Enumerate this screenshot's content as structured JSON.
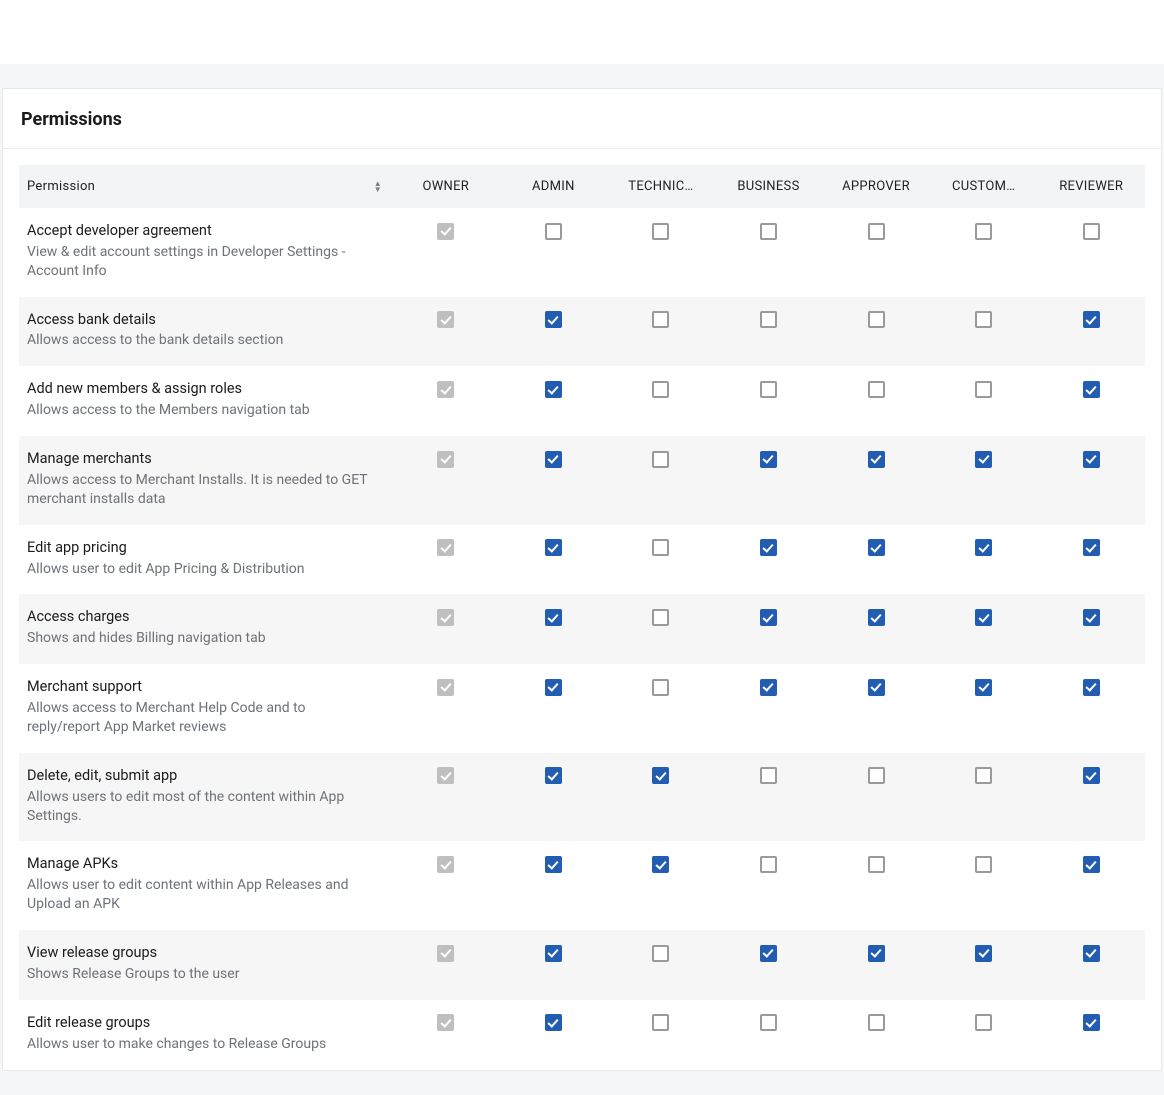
{
  "card_title": "Permissions",
  "columns": [
    "Permission",
    "OWNER",
    "ADMIN",
    "TECHNIC…",
    "BUSINESS",
    "APPROVER",
    "CUSTOM…",
    "REVIEWER"
  ],
  "permissions": [
    {
      "label": "Accept developer agreement",
      "desc": "View & edit account settings in Developer Settings - Account Info",
      "grants": [
        "locked",
        "unchecked",
        "unchecked",
        "unchecked",
        "unchecked",
        "unchecked",
        "unchecked"
      ]
    },
    {
      "label": "Access bank details",
      "desc": "Allows access to the bank details section",
      "grants": [
        "locked",
        "checked",
        "unchecked",
        "unchecked",
        "unchecked",
        "unchecked",
        "checked"
      ]
    },
    {
      "label": "Add new members & assign roles",
      "desc": "Allows access to the Members navigation tab",
      "grants": [
        "locked",
        "checked",
        "unchecked",
        "unchecked",
        "unchecked",
        "unchecked",
        "checked"
      ]
    },
    {
      "label": "Manage merchants",
      "desc": "Allows access to Merchant Installs. It is needed to GET merchant installs data",
      "grants": [
        "locked",
        "checked",
        "unchecked",
        "checked",
        "checked",
        "checked",
        "checked"
      ]
    },
    {
      "label": "Edit app pricing",
      "desc": "Allows user to edit App Pricing & Distribution",
      "grants": [
        "locked",
        "checked",
        "unchecked",
        "checked",
        "checked",
        "checked",
        "checked"
      ]
    },
    {
      "label": "Access charges",
      "desc": "Shows and hides Billing navigation tab",
      "grants": [
        "locked",
        "checked",
        "unchecked",
        "checked",
        "checked",
        "checked",
        "checked"
      ]
    },
    {
      "label": "Merchant support",
      "desc": "Allows access to Merchant Help Code and to reply/report App Market reviews",
      "grants": [
        "locked",
        "checked",
        "unchecked",
        "checked",
        "checked",
        "checked",
        "checked"
      ]
    },
    {
      "label": "Delete, edit, submit app",
      "desc": "Allows users to edit most of the content within App Settings.",
      "grants": [
        "locked",
        "checked",
        "checked",
        "unchecked",
        "unchecked",
        "unchecked",
        "checked"
      ]
    },
    {
      "label": "Manage APKs",
      "desc": "Allows user to edit content within App Releases and Upload an APK",
      "grants": [
        "locked",
        "checked",
        "checked",
        "unchecked",
        "unchecked",
        "unchecked",
        "checked"
      ]
    },
    {
      "label": "View release groups",
      "desc": "Shows Release Groups to the user",
      "grants": [
        "locked",
        "checked",
        "unchecked",
        "checked",
        "checked",
        "checked",
        "checked"
      ]
    },
    {
      "label": "Edit release groups",
      "desc": "Allows user to make changes to Release Groups",
      "grants": [
        "locked",
        "checked",
        "unchecked",
        "unchecked",
        "unchecked",
        "unchecked",
        "checked"
      ]
    }
  ]
}
